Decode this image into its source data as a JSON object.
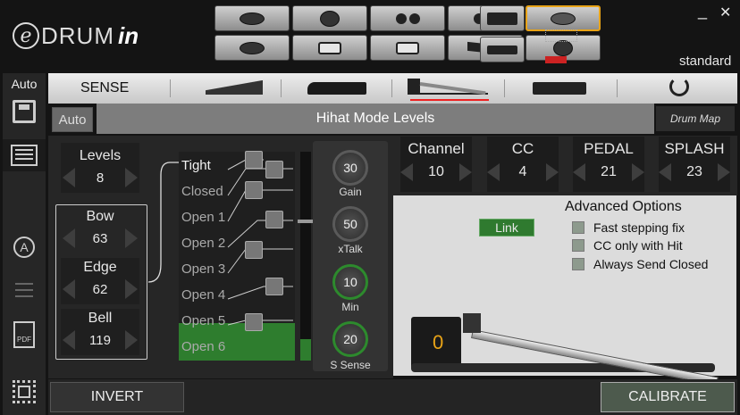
{
  "app": {
    "logo_e": "e",
    "logo_drum": "DRUM",
    "logo_in": "in",
    "profile": "standard",
    "minimize": "_",
    "close": "✕"
  },
  "sidebar": {
    "auto": "Auto",
    "pdf": "PDF"
  },
  "sense": {
    "label": "SENSE"
  },
  "mode": {
    "auto": "Auto",
    "title": "Hihat Mode Levels",
    "drum_map": "Drum Map"
  },
  "levels": {
    "name": "Levels",
    "value": "8"
  },
  "bow": {
    "name": "Bow",
    "value": "63"
  },
  "edge": {
    "name": "Edge",
    "value": "62"
  },
  "bell": {
    "name": "Bell",
    "value": "119"
  },
  "level_items": [
    "Tight",
    "Closed",
    "Open 1",
    "Open 2",
    "Open 3",
    "Open 4",
    "Open 5",
    "Open 6"
  ],
  "knobs": [
    {
      "value": "30",
      "label": "Gain"
    },
    {
      "value": "50",
      "label": "xTalk"
    },
    {
      "value": "10",
      "label": "Min"
    },
    {
      "value": "20",
      "label": "S Sense"
    }
  ],
  "channels": [
    {
      "name": "Channel",
      "value": "10"
    },
    {
      "name": "CC",
      "value": "4"
    },
    {
      "name": "PEDAL",
      "value": "21"
    },
    {
      "name": "SPLASH",
      "value": "23"
    }
  ],
  "advanced": {
    "title": "Advanced Options",
    "link": "Link",
    "options": [
      "Fast stepping fix",
      "CC only with Hit",
      "Always Send Closed"
    ],
    "pedal_value": "0"
  },
  "bottom": {
    "invert": "INVERT",
    "calibrate": "CALIBRATE"
  },
  "colors": {
    "accent_green": "#2e7d2e",
    "selected_pad_border": "#e8a317",
    "link_button": "#2f7a2f"
  }
}
